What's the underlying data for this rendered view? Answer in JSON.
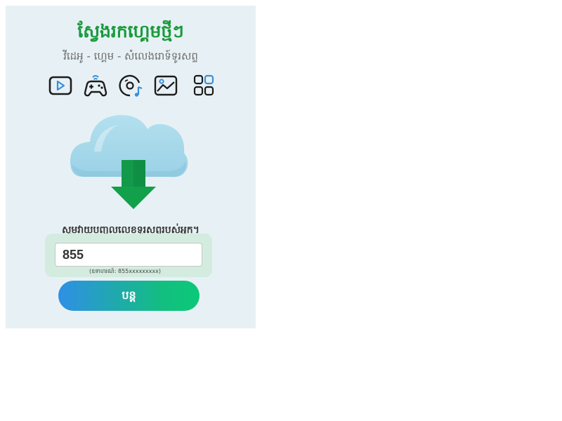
{
  "header": {
    "title": "ស្វែងរកហ្គេមថ្មីៗ",
    "subtitle": "វីដេអូ - ហ្គេម - សំលេងរោទ៍ទូរសព្ទ"
  },
  "categories": [
    {
      "icon": "video-icon"
    },
    {
      "icon": "gamepad-icon"
    },
    {
      "icon": "music-disc-icon"
    },
    {
      "icon": "image-icon"
    },
    {
      "icon": "apps-grid-icon"
    }
  ],
  "hero": {
    "icon": "cloud-download-icon"
  },
  "form": {
    "prompt": "សូមវាយបញ្ចូលលេខទូរសព្ទរបស់អ្នក។",
    "phone_value": "855",
    "example": "(ឧទាហរណ៍: 855xxxxxxxxx)",
    "submit_label": "បន្ត"
  },
  "colors": {
    "title": "#1a9a3c",
    "card_background": "#e7f1f5",
    "input_panel": "#d3ecdf",
    "button_gradient_start": "#2f8fe6",
    "button_gradient_end": "#0bc97a"
  }
}
